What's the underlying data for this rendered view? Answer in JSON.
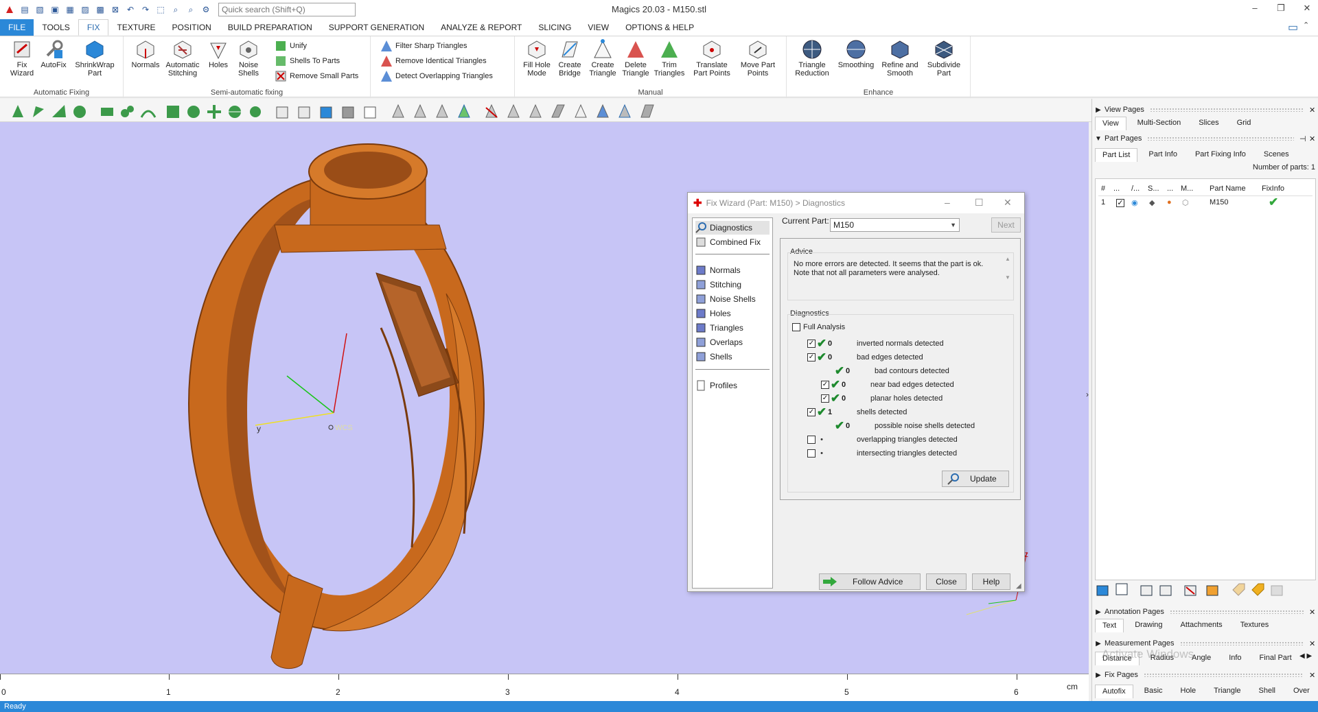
{
  "app": {
    "title": "Magics 20.03 - M150.stl",
    "search_placeholder": "Quick search (Shift+Q)",
    "status": "Ready"
  },
  "menu": {
    "tabs": [
      "FILE",
      "TOOLS",
      "FIX",
      "TEXTURE",
      "POSITION",
      "BUILD PREPARATION",
      "SUPPORT GENERATION",
      "ANALYZE & REPORT",
      "SLICING",
      "VIEW",
      "OPTIONS & HELP"
    ],
    "active": "FIX"
  },
  "ribbon": {
    "automatic_fixing": {
      "label": "Automatic Fixing",
      "buttons": [
        "Fix Wizard",
        "AutoFix",
        "ShrinkWrap Part"
      ]
    },
    "semi_automatic": {
      "label": "Semi-automatic fixing",
      "buttons": [
        "Normals",
        "Automatic Stitching",
        "Holes",
        "Noise Shells"
      ],
      "small": [
        "Unify",
        "Shells To Parts",
        "Remove Small Parts"
      ]
    },
    "triangles_small": [
      "Filter Sharp Triangles",
      "Remove Identical Triangles",
      "Detect Overlapping Triangles"
    ],
    "manual": {
      "label": "Manual",
      "buttons": [
        "Fill Hole Mode",
        "Create Bridge",
        "Create Triangle",
        "Delete Triangle",
        "Trim Triangles",
        "Translate Part Points",
        "Move Part Points"
      ]
    },
    "enhance": {
      "label": "Enhance",
      "buttons": [
        "Triangle Reduction",
        "Smoothing",
        "Refine and Smooth",
        "Subdivide Part"
      ]
    }
  },
  "viewport": {
    "axis_labels": {
      "x": "x",
      "y": "y",
      "z": "z",
      "wcs": "WCS"
    },
    "ruler": {
      "ticks": [
        "0",
        "1",
        "2",
        "3",
        "4",
        "5",
        "6"
      ],
      "unit": "cm"
    },
    "background": "#c7c5f6",
    "part_color": "#c8691d"
  },
  "wizard": {
    "title": "Fix Wizard (Part: M150) > Diagnostics",
    "nav": {
      "top": [
        "Diagnostics",
        "Combined Fix"
      ],
      "middle": [
        "Normals",
        "Stitching",
        "Noise Shells",
        "Holes",
        "Triangles",
        "Overlaps",
        "Shells"
      ],
      "bottom": [
        "Profiles"
      ]
    },
    "current_part_label": "Current Part:",
    "current_part": "M150",
    "next": "Next",
    "advice_title": "Advice",
    "advice_text": "No more errors are detected. It seems that the part is ok. Note that not all parameters were analysed.",
    "diagnostics_title": "Diagnostics",
    "full_analysis": "Full Analysis",
    "rows": [
      {
        "count": "0",
        "label": "inverted normals detected"
      },
      {
        "count": "0",
        "label": "bad edges detected"
      },
      {
        "count": "0",
        "label": "bad contours detected"
      },
      {
        "count": "0",
        "label": "near bad edges detected"
      },
      {
        "count": "0",
        "label": "planar holes detected"
      },
      {
        "count": "1",
        "label": "shells detected"
      },
      {
        "count": "0",
        "label": "possible noise shells detected"
      },
      {
        "count": "",
        "label": "overlapping triangles detected"
      },
      {
        "count": "",
        "label": "intersecting triangles detected"
      }
    ],
    "update": "Update",
    "follow_advice": "Follow Advice",
    "close": "Close",
    "help": "Help"
  },
  "right_panel": {
    "view_pages": {
      "title": "View Pages",
      "tabs": [
        "View",
        "Multi-Section",
        "Slices",
        "Grid"
      ]
    },
    "part_pages": {
      "title": "Part Pages",
      "tabs": [
        "Part List",
        "Part Info",
        "Part Fixing Info",
        "Scenes"
      ],
      "num_parts": "Number of parts: 1"
    },
    "part_columns": [
      "#",
      "...",
      "/...",
      "S...",
      "...",
      "M...",
      "Part Name",
      "FixInfo"
    ],
    "part_row": {
      "index": "1",
      "name": "M150"
    },
    "annotation_pages": {
      "title": "Annotation Pages",
      "tabs": [
        "Text",
        "Drawing",
        "Attachments",
        "Textures"
      ]
    },
    "measurement_pages": {
      "title": "Measurement Pages",
      "tabs": [
        "Distance",
        "Radius",
        "Angle",
        "Info",
        "Final Part"
      ]
    },
    "fix_pages": {
      "title": "Fix Pages",
      "tabs": [
        "Autofix",
        "Basic",
        "Hole",
        "Triangle",
        "Shell",
        "Over"
      ]
    },
    "watermark": "Activate Windows"
  }
}
